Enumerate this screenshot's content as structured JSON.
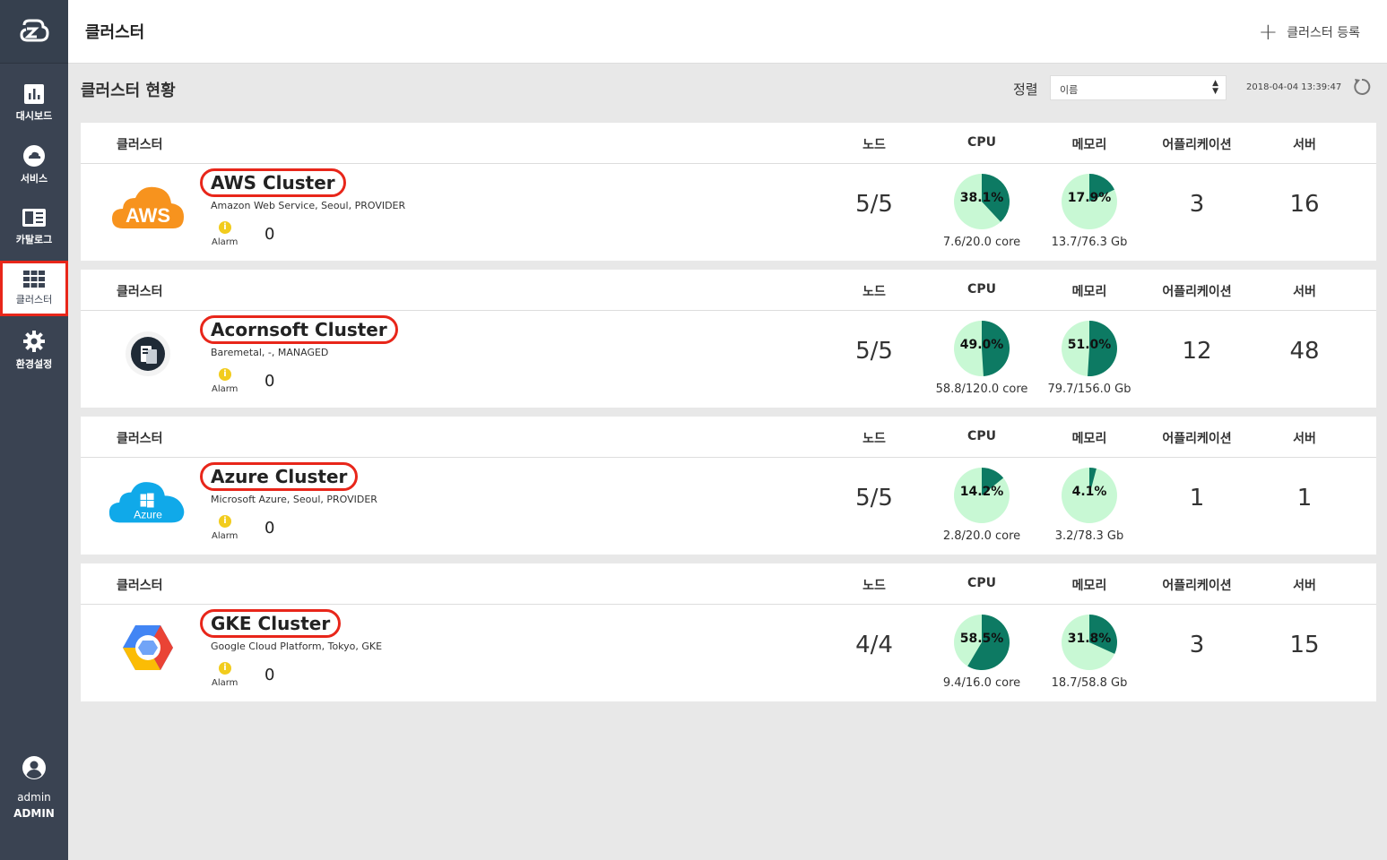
{
  "sidebar": {
    "items": [
      {
        "label": "대시보드",
        "icon": "bar-chart-icon"
      },
      {
        "label": "서비스",
        "icon": "cloud-icon"
      },
      {
        "label": "카탈로그",
        "icon": "catalog-icon"
      },
      {
        "label": "클러스터",
        "icon": "grid-icon"
      },
      {
        "label": "환경설정",
        "icon": "gear-icon"
      }
    ],
    "user": {
      "name": "admin",
      "role": "ADMIN"
    }
  },
  "header": {
    "title": "클러스터",
    "add_label": "클러스터 등록"
  },
  "section": {
    "title": "클러스터 현황",
    "sort_label": "정렬",
    "sort_value": "이름",
    "timestamp": "2018-04-04 13:39:47"
  },
  "columns": {
    "cluster": "클러스터",
    "node": "노드",
    "cpu": "CPU",
    "memory": "메모리",
    "app": "어플리케이션",
    "server": "서버"
  },
  "colors": {
    "pie_fill": "#0d7a63",
    "pie_bg": "#c8f8d4",
    "highlight": "#e8261a",
    "alarm": "#f2cc1d"
  },
  "clusters": [
    {
      "name": "AWS Cluster",
      "desc": "Amazon Web Service, Seoul, PROVIDER",
      "alarm_label": "Alarm",
      "alarm_count": "0",
      "nodes": "5/5",
      "cpu_pct": 38.1,
      "cpu_label": "38.1%",
      "cpu_detail": "7.6/20.0 core",
      "mem_pct": 17.9,
      "mem_label": "17.9%",
      "mem_detail": "13.7/76.3 Gb",
      "apps": "3",
      "servers": "16",
      "logo": "aws-logo"
    },
    {
      "name": "Acornsoft Cluster",
      "desc": "Baremetal, -, MANAGED",
      "alarm_label": "Alarm",
      "alarm_count": "0",
      "nodes": "5/5",
      "cpu_pct": 49.0,
      "cpu_label": "49.0%",
      "cpu_detail": "58.8/120.0 core",
      "mem_pct": 51.0,
      "mem_label": "51.0%",
      "mem_detail": "79.7/156.0 Gb",
      "apps": "12",
      "servers": "48",
      "logo": "baremetal-logo"
    },
    {
      "name": "Azure Cluster",
      "desc": "Microsoft Azure, Seoul, PROVIDER",
      "alarm_label": "Alarm",
      "alarm_count": "0",
      "nodes": "5/5",
      "cpu_pct": 14.2,
      "cpu_label": "14.2%",
      "cpu_detail": "2.8/20.0 core",
      "mem_pct": 4.1,
      "mem_label": "4.1%",
      "mem_detail": "3.2/78.3 Gb",
      "apps": "1",
      "servers": "1",
      "logo": "azure-logo",
      "logo_text": "Azure"
    },
    {
      "name": "GKE Cluster",
      "desc": "Google Cloud Platform, Tokyo, GKE",
      "alarm_label": "Alarm",
      "alarm_count": "0",
      "nodes": "4/4",
      "cpu_pct": 58.5,
      "cpu_label": "58.5%",
      "cpu_detail": "9.4/16.0 core",
      "mem_pct": 31.8,
      "mem_label": "31.8%",
      "mem_detail": "18.7/58.8 Gb",
      "apps": "3",
      "servers": "15",
      "logo": "gke-logo"
    }
  ],
  "aws_logo_text": "AWS"
}
